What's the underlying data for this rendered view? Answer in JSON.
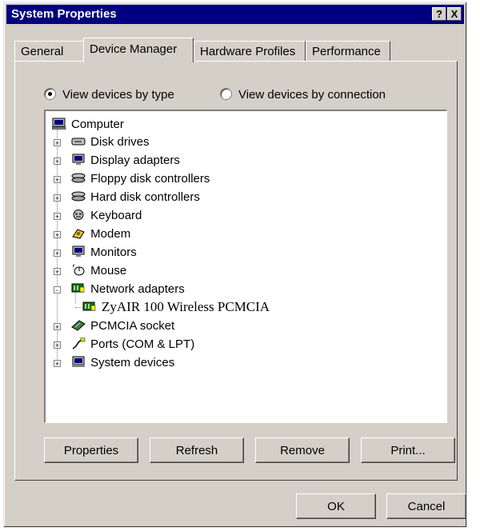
{
  "window": {
    "title": "System Properties",
    "help_button": "?",
    "close_button": "X"
  },
  "tabs": [
    {
      "label": "General"
    },
    {
      "label": "Device Manager",
      "active": true
    },
    {
      "label": "Hardware Profiles"
    },
    {
      "label": "Performance"
    }
  ],
  "view_options": {
    "by_type": {
      "label": "View devices by type",
      "selected": true
    },
    "by_connection": {
      "label": "View devices by connection",
      "selected": false
    }
  },
  "tree": {
    "root": {
      "label": "Computer",
      "icon": "computer-icon"
    },
    "items": [
      {
        "label": "Disk drives",
        "icon": "disk-drive-icon",
        "expander": "+"
      },
      {
        "label": "Display adapters",
        "icon": "monitor-icon",
        "expander": "+"
      },
      {
        "label": "Floppy disk controllers",
        "icon": "controller-icon",
        "expander": "+"
      },
      {
        "label": "Hard disk controllers",
        "icon": "controller-icon",
        "expander": "+"
      },
      {
        "label": "Keyboard",
        "icon": "keyboard-icon",
        "expander": "+"
      },
      {
        "label": "Modem",
        "icon": "modem-icon",
        "expander": "+"
      },
      {
        "label": "Monitors",
        "icon": "monitor-icon",
        "expander": "+"
      },
      {
        "label": "Mouse",
        "icon": "mouse-icon",
        "expander": "+"
      },
      {
        "label": "Network adapters",
        "icon": "network-card-icon",
        "expander": "-"
      },
      {
        "label": "PCMCIA socket",
        "icon": "pcmcia-icon",
        "expander": "+"
      },
      {
        "label": "Ports (COM & LPT)",
        "icon": "port-icon",
        "expander": "+"
      },
      {
        "label": "System devices",
        "icon": "system-icon",
        "expander": "+"
      }
    ],
    "child": {
      "label": "ZyAIR 100 Wireless PCMCIA",
      "icon": "network-card-icon"
    }
  },
  "buttons": {
    "properties": "Properties",
    "refresh": "Refresh",
    "remove": "Remove",
    "print": "Print...",
    "ok": "OK",
    "cancel": "Cancel"
  },
  "colors": {
    "titlebar": "#000080",
    "face": "#d4d0c8"
  }
}
